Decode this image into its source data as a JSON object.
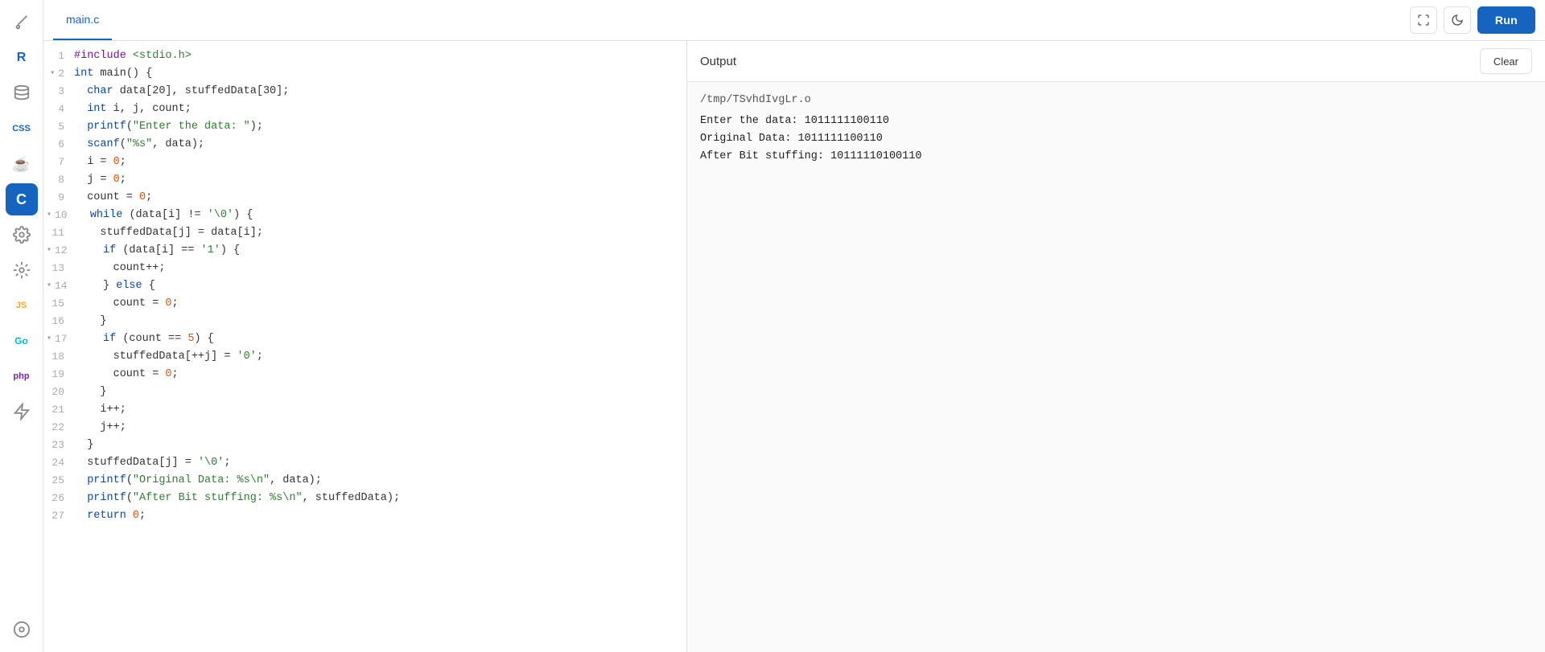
{
  "sidebar": {
    "icons": [
      {
        "name": "brush-icon",
        "symbol": "🖌",
        "active": false
      },
      {
        "name": "r-icon",
        "symbol": "R",
        "active": false
      },
      {
        "name": "database-icon",
        "symbol": "🗄",
        "active": false
      },
      {
        "name": "css-icon",
        "symbol": "◻",
        "active": false
      },
      {
        "name": "java-icon",
        "symbol": "☕",
        "active": false
      },
      {
        "name": "c-icon",
        "symbol": "C",
        "active": true
      },
      {
        "name": "gear-icon",
        "symbol": "⚙",
        "active": false
      },
      {
        "name": "gear2-icon",
        "symbol": "⚙",
        "active": false
      },
      {
        "name": "js-icon",
        "symbol": "JS",
        "active": false
      },
      {
        "name": "go-icon",
        "symbol": "Go",
        "active": false
      },
      {
        "name": "php-icon",
        "symbol": "php",
        "active": false
      },
      {
        "name": "swift-icon",
        "symbol": "◈",
        "active": false
      },
      {
        "name": "bottom-icon",
        "symbol": "⊕",
        "active": false
      }
    ]
  },
  "topbar": {
    "tab_label": "main.c",
    "fullscreen_title": "fullscreen",
    "dark_mode_title": "dark mode",
    "run_label": "Run"
  },
  "output": {
    "title": "Output",
    "clear_label": "Clear",
    "lines": [
      "/tmp/TSvhdIvgLr.o",
      "Enter the data: 1011111100110",
      "Original Data: 1011111100110",
      "After Bit stuffing: 10111110100110"
    ]
  },
  "code": {
    "lines": [
      {
        "num": "1",
        "fold": false,
        "html": "<span class='pp'>#include</span> <span class='str'>&lt;stdio.h&gt;</span>"
      },
      {
        "num": "2",
        "fold": true,
        "html": "<span class='kw'>int</span> <span class='plain'>main() {</span>"
      },
      {
        "num": "3",
        "fold": false,
        "html": "  <span class='kw'>char</span> <span class='plain'>data[20], stuffedData[30];</span>"
      },
      {
        "num": "4",
        "fold": false,
        "html": "  <span class='kw'>int</span> <span class='plain'>i, j, count;</span>"
      },
      {
        "num": "5",
        "fold": false,
        "html": "  <span class='fn'>printf</span><span class='plain'>(</span><span class='str'>\"Enter the data: \"</span><span class='plain'>);</span>"
      },
      {
        "num": "6",
        "fold": false,
        "html": "  <span class='fn'>scanf</span><span class='plain'>(</span><span class='str'>\"%s\"</span><span class='plain'>, data);</span>"
      },
      {
        "num": "7",
        "fold": false,
        "html": "  <span class='plain'>i = </span><span class='num'>0</span><span class='plain'>;</span>"
      },
      {
        "num": "8",
        "fold": false,
        "html": "  <span class='plain'>j = </span><span class='num'>0</span><span class='plain'>;</span>"
      },
      {
        "num": "9",
        "fold": false,
        "html": "  <span class='plain'>count = </span><span class='num'>0</span><span class='plain'>;</span>"
      },
      {
        "num": "10",
        "fold": true,
        "html": "  <span class='kw'>while</span> <span class='plain'>(data[i] != </span><span class='str'>'\\0'</span><span class='plain'>) {</span>"
      },
      {
        "num": "11",
        "fold": false,
        "html": "    <span class='plain'>stuffedData[j] = data[i];</span>"
      },
      {
        "num": "12",
        "fold": true,
        "html": "    <span class='kw'>if</span> <span class='plain'>(data[i] == </span><span class='str'>'1'</span><span class='plain'>) {</span>"
      },
      {
        "num": "13",
        "fold": false,
        "html": "      <span class='plain'>count++;</span>"
      },
      {
        "num": "14",
        "fold": true,
        "html": "    <span class='plain'>} </span><span class='kw'>else</span><span class='plain'> {</span>"
      },
      {
        "num": "15",
        "fold": false,
        "html": "      <span class='plain'>count = </span><span class='num'>0</span><span class='plain'>;</span>"
      },
      {
        "num": "16",
        "fold": false,
        "html": "    <span class='plain'>}</span>"
      },
      {
        "num": "17",
        "fold": true,
        "html": "    <span class='kw'>if</span> <span class='plain'>(count == </span><span class='num'>5</span><span class='plain'>) {</span>"
      },
      {
        "num": "18",
        "fold": false,
        "html": "      <span class='plain'>stuffedData[++j] = </span><span class='str'>'0'</span><span class='plain'>;</span>"
      },
      {
        "num": "19",
        "fold": false,
        "html": "      <span class='plain'>count = </span><span class='num'>0</span><span class='plain'>;</span>"
      },
      {
        "num": "20",
        "fold": false,
        "html": "    <span class='plain'>}</span>"
      },
      {
        "num": "21",
        "fold": false,
        "html": "    <span class='plain'>i++;</span>"
      },
      {
        "num": "22",
        "fold": false,
        "html": "    <span class='plain'>j++;</span>"
      },
      {
        "num": "23",
        "fold": false,
        "html": "  <span class='plain'>}</span>"
      },
      {
        "num": "24",
        "fold": false,
        "html": "  <span class='plain'>stuffedData[j] = </span><span class='str'>'\\0'</span><span class='plain'>;</span>"
      },
      {
        "num": "25",
        "fold": false,
        "html": "  <span class='fn'>printf</span><span class='plain'>(</span><span class='str'>\"Original Data: %s\\n\"</span><span class='plain'>, data);</span>"
      },
      {
        "num": "26",
        "fold": false,
        "html": "  <span class='fn'>printf</span><span class='plain'>(</span><span class='str'>\"After Bit stuffing: %s\\n\"</span><span class='plain'>, stuffedData);</span>"
      },
      {
        "num": "27",
        "fold": false,
        "html": "  <span class='kw'>return</span> <span class='num'>0</span><span class='plain'>;</span>"
      }
    ]
  }
}
